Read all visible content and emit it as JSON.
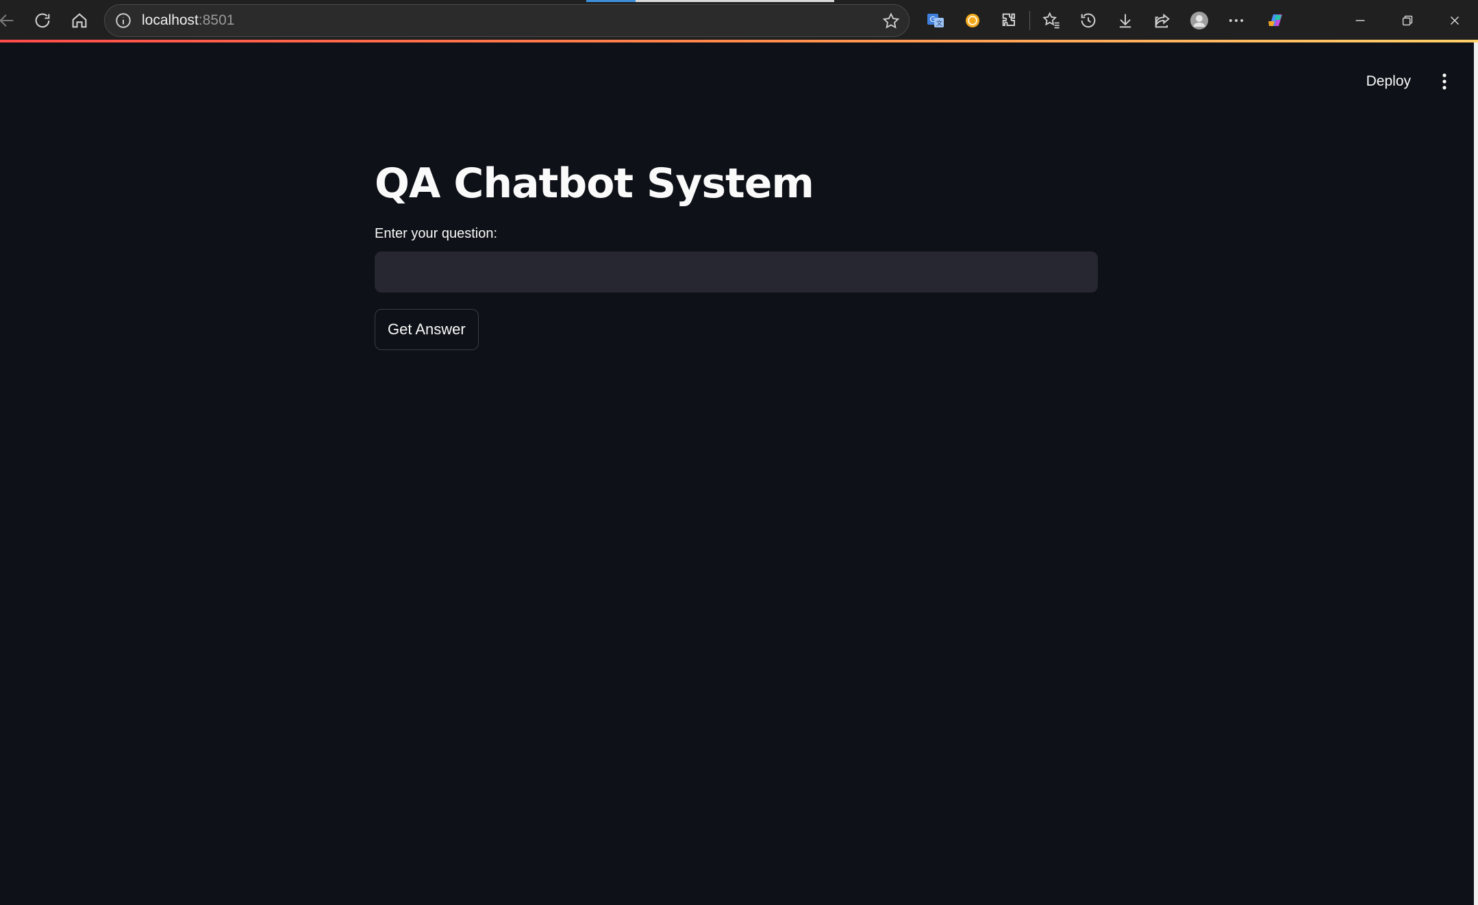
{
  "browser": {
    "url_host": "localhost",
    "url_port": ":8501",
    "toolbar_icons": [
      "translate-icon",
      "coin-extension-icon",
      "extensions-icon",
      "favorites-icon",
      "history-icon",
      "download-icon",
      "share-icon",
      "profile-avatar-icon",
      "more-options-icon",
      "copilot-icon"
    ]
  },
  "app": {
    "header": {
      "deploy_label": "Deploy"
    },
    "title": "QA Chatbot System",
    "question_label": "Enter your question:",
    "question_value": "",
    "question_placeholder": "",
    "button_label": "Get Answer"
  },
  "colors": {
    "background": "#0e1117",
    "input_background": "#262730",
    "text": "#fafafa",
    "progress_gradient_start": "#ff4b4b",
    "progress_gradient_end": "#ffd16a"
  }
}
